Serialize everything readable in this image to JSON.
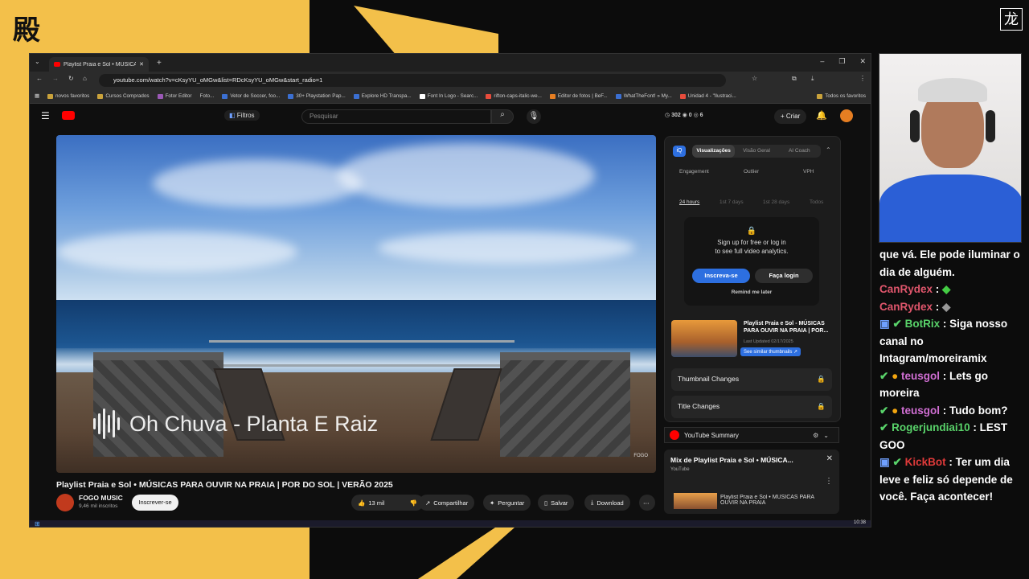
{
  "browser": {
    "tab_title": "Playlist Praia e Sol • MÚSICAS P",
    "url": "youtube.com/watch?v=cKsyYU_oMGw&list=RDcKsyYU_oMGw&start_radio=1",
    "bookmarks": [
      "novos favoritos",
      "Cursos Comprados",
      "Fotor Editor",
      "Foto...",
      "Vetor de Soccer, foo...",
      "30+ Playstation Pap...",
      "Explore HD Transpa...",
      "Font In Logo - Searc...",
      "rifton-caps-italic-we...",
      "Editor de fotos | BeF...",
      "WhatTheFont! » My...",
      "Unidad 4 - \"Ilustraci...",
      "Todos os favoritos"
    ]
  },
  "youtube": {
    "filters_label": "Filtros",
    "search_placeholder": "Pesquisar",
    "stats": [
      "302",
      "0",
      "6"
    ],
    "create_label": "Criar",
    "video_overlay_title": "Oh Chuva - Planta E Raiz",
    "video_title": "Playlist Praia e Sol • MÚSICAS PARA OUVIR NA PRAIA | POR DO SOL | VERÃO 2025",
    "channel_name": "FOGO MUSIC",
    "channel_subs": "9,46 mil inscritos",
    "subscribe_label": "Inscrever-se",
    "like_count": "13 mil",
    "share_label": "Compartilhar",
    "ask_label": "Perguntar",
    "save_label": "Salvar",
    "download_label": "Download",
    "watermark": "FOGO"
  },
  "panel": {
    "tabs": [
      "Visualizações",
      "Visão Geral",
      "AI Coach"
    ],
    "metrics": [
      "Engagement",
      "Outlier",
      "VPH"
    ],
    "ranges": [
      "24 hours",
      "1st 7 days",
      "1st 28 days",
      "Todos"
    ],
    "lock_text_1": "Sign up for free or log in",
    "lock_text_2": "to see full video analytics.",
    "signup_label": "Inscreva-se",
    "login_label": "Faça login",
    "remind_label": "Remind me later",
    "thumb_title": "Playlist Praia e Sol - MÚSICAS PARA OUVIR NA PRAIA | POR...",
    "thumb_updated": "Last Updated 02/17/2025",
    "similar_label": "See similar thumbnails",
    "thumbnail_changes": "Thumbnail Changes",
    "title_changes": "Title Changes",
    "summary_label": "YouTube Summary",
    "mix_title": "Mix de Playlist Praia e Sol • MÚSICA...",
    "mix_channel": "YouTube",
    "mix_item": "Playlist Praia e Sol • MÚSICAS PARA OUVIR NA PRAIA"
  },
  "taskbar": {
    "time": "10:38"
  },
  "chat": [
    {
      "user": "",
      "text": "que vá. Ele pode iluminar o dia de alguém."
    },
    {
      "user": "CanRydex",
      "text": ""
    },
    {
      "user": "CanRydex",
      "text": ""
    },
    {
      "user": "BotRix",
      "text": "Siga nosso canal no Intagram/moreiramix"
    },
    {
      "user": "teusgol",
      "text": "Lets go moreira"
    },
    {
      "user": "teusgol",
      "text": "Tudo bom?"
    },
    {
      "user": "Rogerjundiai10",
      "text": "LEST GOO"
    },
    {
      "user": "KickBot",
      "text": "Ter um dia leve e feliz só depende de você. Faça acontecer!"
    }
  ],
  "colors": {
    "yellow": "#f3c04a",
    "yt_red": "#ff0000",
    "blue": "#2d6fe0"
  }
}
